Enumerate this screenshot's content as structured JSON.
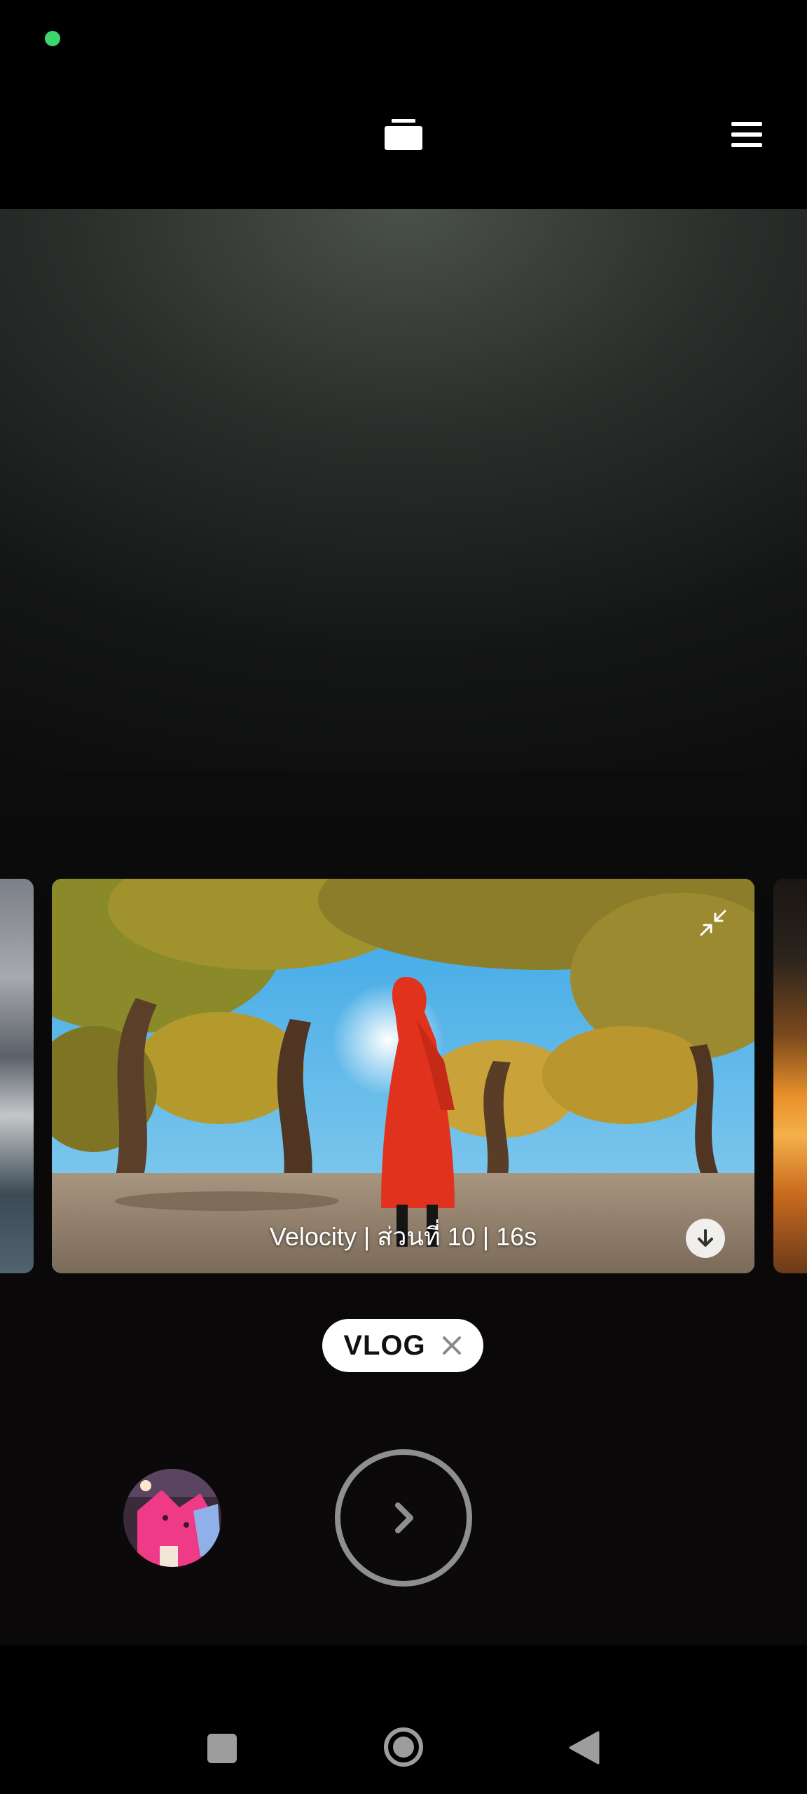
{
  "topbar": {
    "aspect_ratio_icon": "aspect-ratio-icon",
    "menu_icon": "menu-icon"
  },
  "carousel": {
    "selected": {
      "caption": "Velocity | ส่วนที่ 10 | 16s",
      "collapse_icon": "collapse-icon",
      "download_icon": "download-icon"
    }
  },
  "mode_chip": {
    "label": "VLOG",
    "close_icon": "close-icon"
  },
  "controls": {
    "gallery_icon": "gallery-thumbnail",
    "shutter_icon": "chevron-right-icon"
  },
  "navbar": {
    "recents_icon": "square-icon",
    "home_icon": "circle-icon",
    "back_icon": "triangle-back-icon"
  },
  "colors": {
    "status_dot": "#3dd56d",
    "chip_bg": "#ffffff",
    "shutter_ring": "#8f8f8f"
  }
}
